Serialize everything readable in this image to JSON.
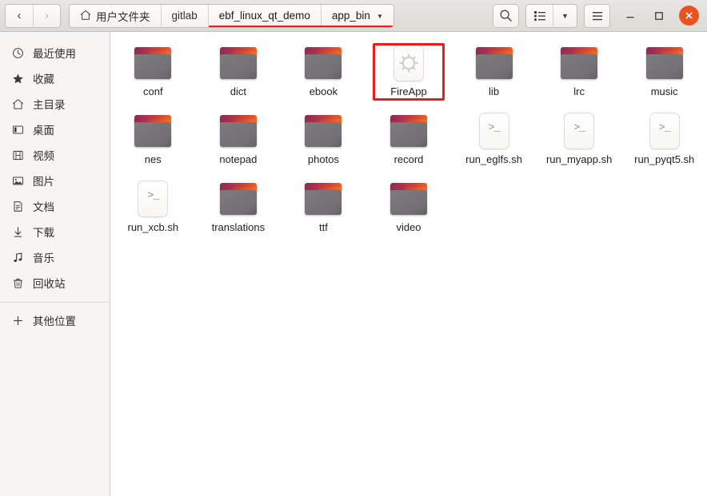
{
  "window": {
    "controls": {
      "minimize_label": "–",
      "maximize_label": "□",
      "close_label": "✕",
      "close_color": "#e9531f"
    }
  },
  "header": {
    "nav": {
      "back_label": "‹",
      "forward_label": "›",
      "back_enabled": true,
      "forward_enabled": false
    },
    "breadcrumbs": [
      {
        "label": "用户文件夹",
        "icon": "home-icon",
        "active": false,
        "has_caret": false
      },
      {
        "label": "gitlab",
        "icon": "",
        "active": false,
        "has_caret": false
      },
      {
        "label": "ebf_linux_qt_demo",
        "icon": "",
        "active": true,
        "has_caret": false
      },
      {
        "label": "app_bin",
        "icon": "",
        "active": true,
        "has_caret": true
      }
    ],
    "caret_label": "▼",
    "annotation_underline_color": "#ef1b1b",
    "toolbar": {
      "search_label": "search-icon",
      "view_list_label": "list-view-icon",
      "view_dropdown_label": "▼",
      "menu_label": "hamburger-menu-icon"
    }
  },
  "sidebar": {
    "items": [
      {
        "label": "最近使用",
        "icon": "clock-icon"
      },
      {
        "label": "收藏",
        "icon": "star-icon"
      },
      {
        "label": "主目录",
        "icon": "home-icon"
      },
      {
        "label": "桌面",
        "icon": "desktop-icon"
      },
      {
        "label": "视频",
        "icon": "film-icon"
      },
      {
        "label": "图片",
        "icon": "picture-icon"
      },
      {
        "label": "文档",
        "icon": "document-icon"
      },
      {
        "label": "下载",
        "icon": "download-icon"
      },
      {
        "label": "音乐",
        "icon": "music-note-icon"
      },
      {
        "label": "回收站",
        "icon": "trash-icon"
      }
    ],
    "other_locations": {
      "label": "其他位置",
      "icon": "plus-icon"
    }
  },
  "files": [
    {
      "name": "conf",
      "type": "folder",
      "highlighted": false
    },
    {
      "name": "dict",
      "type": "folder",
      "highlighted": false
    },
    {
      "name": "ebook",
      "type": "folder",
      "highlighted": false
    },
    {
      "name": "FireApp",
      "type": "app",
      "highlighted": true
    },
    {
      "name": "lib",
      "type": "folder",
      "highlighted": false
    },
    {
      "name": "lrc",
      "type": "folder",
      "highlighted": false
    },
    {
      "name": "music",
      "type": "folder",
      "highlighted": false
    },
    {
      "name": "nes",
      "type": "folder",
      "highlighted": false
    },
    {
      "name": "notepad",
      "type": "folder",
      "highlighted": false
    },
    {
      "name": "photos",
      "type": "folder",
      "highlighted": false
    },
    {
      "name": "record",
      "type": "folder",
      "highlighted": false
    },
    {
      "name": "run_eglfs.sh",
      "type": "script",
      "highlighted": false
    },
    {
      "name": "run_myapp.sh",
      "type": "script",
      "highlighted": false
    },
    {
      "name": "run_pyqt5.sh",
      "type": "script",
      "highlighted": false
    },
    {
      "name": "run_xcb.sh",
      "type": "script",
      "highlighted": false
    },
    {
      "name": "translations",
      "type": "folder",
      "highlighted": false
    },
    {
      "name": "ttf",
      "type": "folder",
      "highlighted": false
    },
    {
      "name": "video",
      "type": "folder",
      "highlighted": false
    }
  ],
  "icons": {
    "script_glyph": ">_",
    "folder_tab_gradient": [
      "#8e2b52",
      "#f26122"
    ],
    "folder_body_color": "#76747a"
  }
}
